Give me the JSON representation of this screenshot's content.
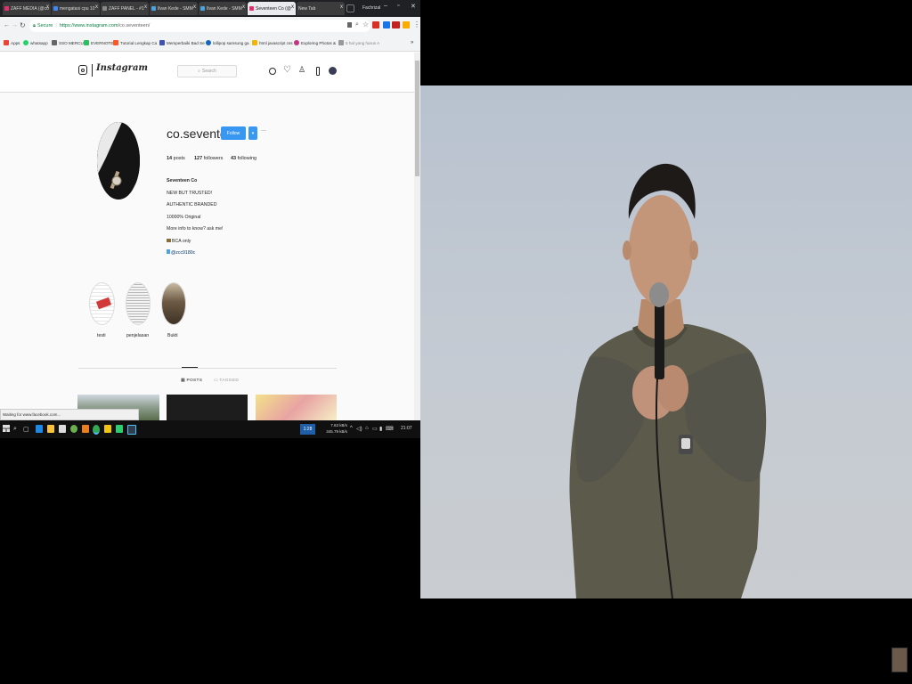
{
  "browser": {
    "tabs": [
      {
        "label": "ZAFF MEDIA (@co",
        "color": "#e1306c"
      },
      {
        "label": "mengatasi cpu 10",
        "color": "#4285f4"
      },
      {
        "label": "ZAFF PANEL - #1",
        "color": "#888888"
      },
      {
        "label": "Ilvan Kede - SMM",
        "color": "#4aa3df"
      },
      {
        "label": "Ilvan Kede - SMM",
        "color": "#4aa3df"
      },
      {
        "label": "Seventeen Co (@",
        "color": "#e1306c"
      },
      {
        "label": "New Tab",
        "color": "#bbbbbb"
      }
    ],
    "user_label": "Fachrizal",
    "secure_label": "Secure",
    "url_host": "https://www.instagram.com",
    "url_path": "/co.seventeen/",
    "bookmarks": [
      {
        "label": "Apps",
        "color": "#ea4335"
      },
      {
        "label": "whatsapp",
        "color": "#25d366"
      },
      {
        "label": "SSO MERCU",
        "color": "#666666"
      },
      {
        "label": "EVERNOTE",
        "color": "#2dbe60"
      },
      {
        "label": "Tutorial Lengkap Ca",
        "color": "#ff5722"
      },
      {
        "label": "Memperbaiki Bad Se",
        "color": "#3f51b5"
      },
      {
        "label": "lollipop samsung ga",
        "color": "#1565c0"
      },
      {
        "label": "html javascript css",
        "color": "#f4b400"
      },
      {
        "label": "Exploring Photos &",
        "color": "#c13584"
      },
      {
        "label": "5 hal yang harus A",
        "color": "#999999"
      }
    ],
    "status_text": "Waiting for www.facebook.com..."
  },
  "instagram": {
    "logo_text": "Instagram",
    "search_placeholder": "Search",
    "username": "co.seventeen",
    "follow_label": "Follow",
    "dropdown_label": "▾",
    "more_label": "···",
    "posts_count": "14",
    "posts_label": "posts",
    "followers_count": "127",
    "followers_label": "followers",
    "following_count": "43",
    "following_label": "following",
    "full_name": "Seventeen Co",
    "bio_lines": [
      "NEW BUT TRUSTED!",
      "AUTHENTIC BRANDED",
      "10000% Original",
      "More info to know? ask me!",
      "BCA only",
      "@zcc9180c"
    ],
    "highlights": [
      {
        "label": "testi",
        "color": "#d23a3a"
      },
      {
        "label": "penjelasan",
        "color": "#bdbdbd"
      },
      {
        "label": "Bukti",
        "color": "#6d5a44"
      }
    ],
    "tab_posts": "POSTS",
    "tab_tagged": "TAGGED"
  },
  "taskbar": {
    "clock": "21:07",
    "net_up": "7.63 kB/s",
    "net_down": "345.79 kB/s",
    "badge": "1:28"
  },
  "colors": {
    "follow_blue": "#3897f0",
    "video_bg": "#c3c9d1",
    "sweater": "#5b5a4b"
  }
}
